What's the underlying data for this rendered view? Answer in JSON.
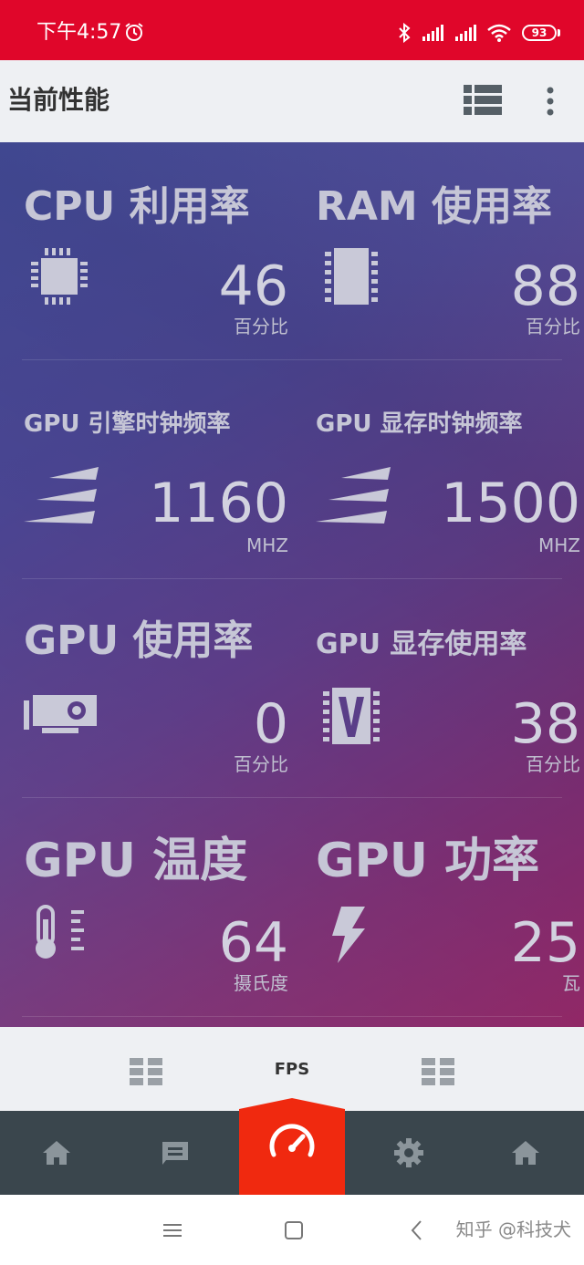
{
  "status_bar": {
    "time": "下午4:57",
    "battery": "93",
    "icons": [
      "alarm-icon",
      "bluetooth-icon",
      "signal-icon",
      "signal-icon",
      "wifi-icon",
      "battery-icon"
    ]
  },
  "app_bar": {
    "title": "当前性能",
    "icons": [
      "list-view-icon",
      "more-vert-icon"
    ]
  },
  "metrics": [
    {
      "title": "CPU 利用率",
      "value": "46",
      "unit": "百分比",
      "icon": "cpu-chip-icon"
    },
    {
      "title": "RAM 使用率",
      "value": "88",
      "unit": "百分比",
      "icon": "ram-module-icon"
    },
    {
      "title": "GPU 引擎时钟频率",
      "value": "1160",
      "unit": "MHZ",
      "icon": "speed-stripes-icon"
    },
    {
      "title": "GPU 显存时钟频率",
      "value": "1500",
      "unit": "MHZ",
      "icon": "speed-stripes-icon"
    },
    {
      "title": "GPU 使用率",
      "value": "0",
      "unit": "百分比",
      "icon": "graphics-card-icon"
    },
    {
      "title": "GPU 显存使用率",
      "value": "38",
      "unit": "百分比",
      "icon": "video-memory-icon"
    },
    {
      "title": "GPU 温度",
      "value": "64",
      "unit": "摄氏度",
      "icon": "thermometer-icon"
    },
    {
      "title": "GPU 功率",
      "value": "25",
      "unit": "瓦",
      "icon": "lightning-bolt-icon"
    }
  ],
  "tab_strip": {
    "center_label": "FPS",
    "icons": [
      "grid-layout-icon",
      "grid-layout-icon"
    ]
  },
  "bottom_nav": {
    "items": [
      "home-icon",
      "message-icon",
      "speedometer-icon",
      "settings-gear-icon",
      "home-icon"
    ],
    "active_index": 2,
    "active_color": "#f0290f"
  },
  "system_nav": {
    "items": [
      "menu-icon",
      "home-square-icon",
      "back-icon"
    ]
  },
  "watermark": "知乎 @科技犬",
  "colors": {
    "status_bar": "#e0062a",
    "bottom_nav": "#3a464d",
    "accent": "#f0290f"
  }
}
